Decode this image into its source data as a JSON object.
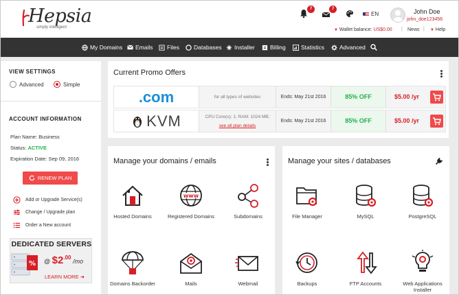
{
  "header": {
    "logo_text": "Hepsia",
    "logo_tagline": "simply intelligent",
    "notifications_count": "7",
    "messages_count": "7",
    "language": "EN",
    "user_name": "John Doe",
    "user_login": "john_doe123456",
    "wallet_label": "Wallet balance: ",
    "wallet_value": "US$0.00",
    "news_label": "News",
    "help_label": "Help"
  },
  "nav": {
    "items": [
      {
        "label": "My Domains",
        "icon": "globe-icon"
      },
      {
        "label": "Emails",
        "icon": "envelope-icon"
      },
      {
        "label": "Files",
        "icon": "files-icon"
      },
      {
        "label": "Databases",
        "icon": "database-icon"
      },
      {
        "label": "Installer",
        "icon": "installer-icon"
      },
      {
        "label": "Billing",
        "icon": "billing-icon"
      },
      {
        "label": "Statistics",
        "icon": "statistics-icon"
      },
      {
        "label": "Advanced",
        "icon": "gear-icon"
      }
    ]
  },
  "sidebar": {
    "view_settings_title": "VIEW SETTINGS",
    "view_advanced": "Advanced",
    "view_simple": "Simple",
    "selected_view": "Simple",
    "account_title": "ACCOUNT INFORMATION",
    "plan_label": "Plan Name: ",
    "plan_value": "Business",
    "status_label": "Status: ",
    "status_value": "ACTIVE",
    "expiration_label": "Expiration Date: ",
    "expiration_value": "Sep 09, 2016",
    "renew_label": "RENEW PLAN",
    "links": [
      "Add or Upgrade Service(s)",
      "Change / Upgrade plan",
      "Order a New account"
    ],
    "ad": {
      "title": "DEDICATED SERVERS",
      "at": "@",
      "price_whole": "$2",
      "price_cents": ".00",
      "per": "/mo",
      "more": "LEARN MORE"
    }
  },
  "promo": {
    "title": "Current Promo Offers",
    "rows": [
      {
        "name": ".com",
        "desc": "for all types of websites",
        "link": "",
        "ends": "Ends: May 21st 2016",
        "discount": "85% OFF",
        "price": "$5.00 /yr"
      },
      {
        "name": "KVM",
        "desc": "CPU Core(s): 1; RAM: 1024 MB;",
        "link": "see all plan details",
        "ends": "Ends: May 21st 2016",
        "discount": "85% OFF",
        "price": "$5.00 /yr"
      }
    ]
  },
  "domains_card": {
    "title": "Manage your domains / emails",
    "tiles": [
      "Hosted Domains",
      "Registered Domains",
      "Subdomains",
      "Domains Backorder",
      "Mails",
      "Webmail"
    ]
  },
  "sites_card": {
    "title": "Manage your sites / databases",
    "tiles": [
      "File Manager",
      "MySQL",
      "PostgreSQL",
      "Backups",
      "FTP Accounts",
      "Web Applications",
      "Installer"
    ]
  },
  "colors": {
    "accent": "#d61f26",
    "success": "#1fb24a",
    "nav_bg": "#333333",
    "com_blue": "#1a8fd6"
  }
}
